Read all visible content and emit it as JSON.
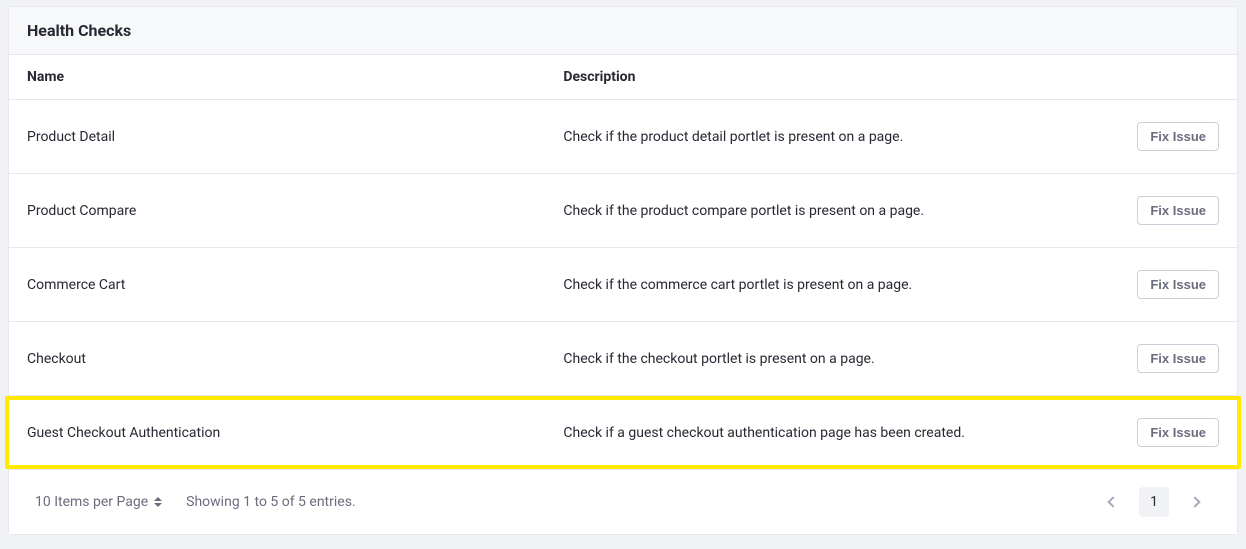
{
  "card": {
    "title": "Health Checks"
  },
  "columns": {
    "name": "Name",
    "description": "Description"
  },
  "rows": [
    {
      "name": "Product Detail",
      "description": "Check if the product detail portlet is present on a page.",
      "action_label": "Fix Issue",
      "highlight": false
    },
    {
      "name": "Product Compare",
      "description": "Check if the product compare portlet is present on a page.",
      "action_label": "Fix Issue",
      "highlight": false
    },
    {
      "name": "Commerce Cart",
      "description": "Check if the commerce cart portlet is present on a page.",
      "action_label": "Fix Issue",
      "highlight": false
    },
    {
      "name": "Checkout",
      "description": "Check if the checkout portlet is present on a page.",
      "action_label": "Fix Issue",
      "highlight": false
    },
    {
      "name": "Guest Checkout Authentication",
      "description": "Check if a guest checkout authentication page has been created.",
      "action_label": "Fix Issue",
      "highlight": true
    }
  ],
  "footer": {
    "items_per_page": "10 Items per Page",
    "showing": "Showing 1 to 5 of 5 entries.",
    "current_page": "1"
  }
}
